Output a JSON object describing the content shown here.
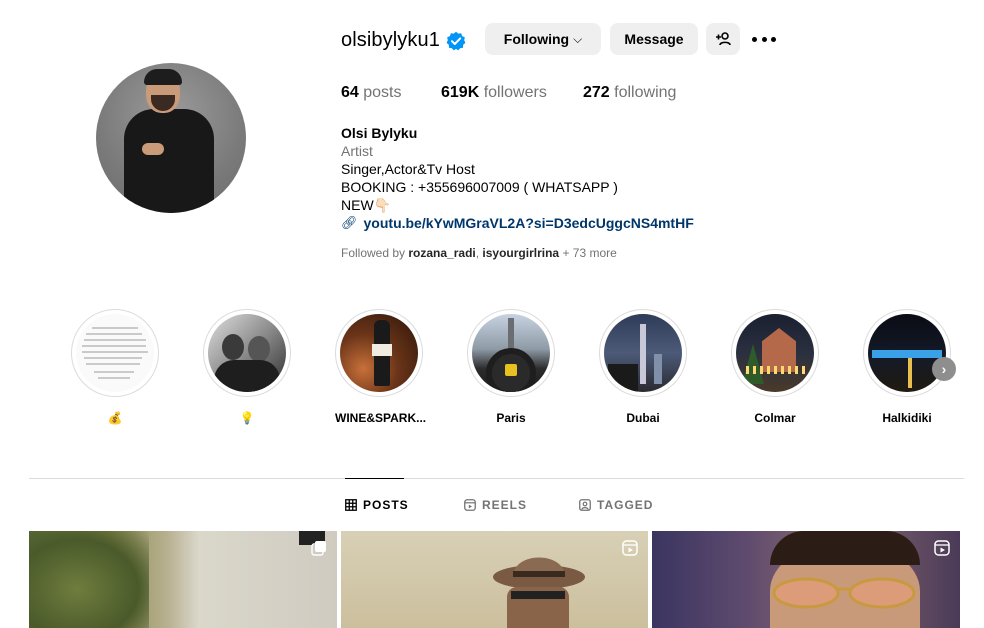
{
  "profile": {
    "username": "olsibylyku1",
    "verified_icon": "verified-badge-icon",
    "following_label": "Following",
    "message_label": "Message",
    "posts_count": "64",
    "posts_label": "posts",
    "followers_count": "619K",
    "followers_label": "followers",
    "following_count": "272",
    "following_label_stat": "following"
  },
  "bio": {
    "name": "Olsi Bylyku",
    "category": "Artist",
    "line1": "Singer,Actor&Tv Host",
    "line2": "BOOKING : +355696007009 ( WHATSAPP )",
    "line3": "NEW👇🏻",
    "link": "youtu.be/kYwMGraVL2A?si=D3edcUggcNS4mtHF"
  },
  "followed_by": {
    "prefix": "Followed by",
    "user1": "rozana_radi",
    "separator": ",",
    "user2": "isyourgirlrina",
    "more": "+ 73 more"
  },
  "highlights": [
    {
      "label": "💰"
    },
    {
      "label": "💡"
    },
    {
      "label": "WINE&SPARK..."
    },
    {
      "label": "Paris"
    },
    {
      "label": "Dubai"
    },
    {
      "label": "Colmar"
    },
    {
      "label": "Halkidiki"
    }
  ],
  "tabs": {
    "posts": "POSTS",
    "reels": "REELS",
    "tagged": "TAGGED"
  },
  "colors": {
    "verified": "#0095f6",
    "link": "#00376b",
    "muted": "#737373",
    "button_bg": "#efefef"
  }
}
